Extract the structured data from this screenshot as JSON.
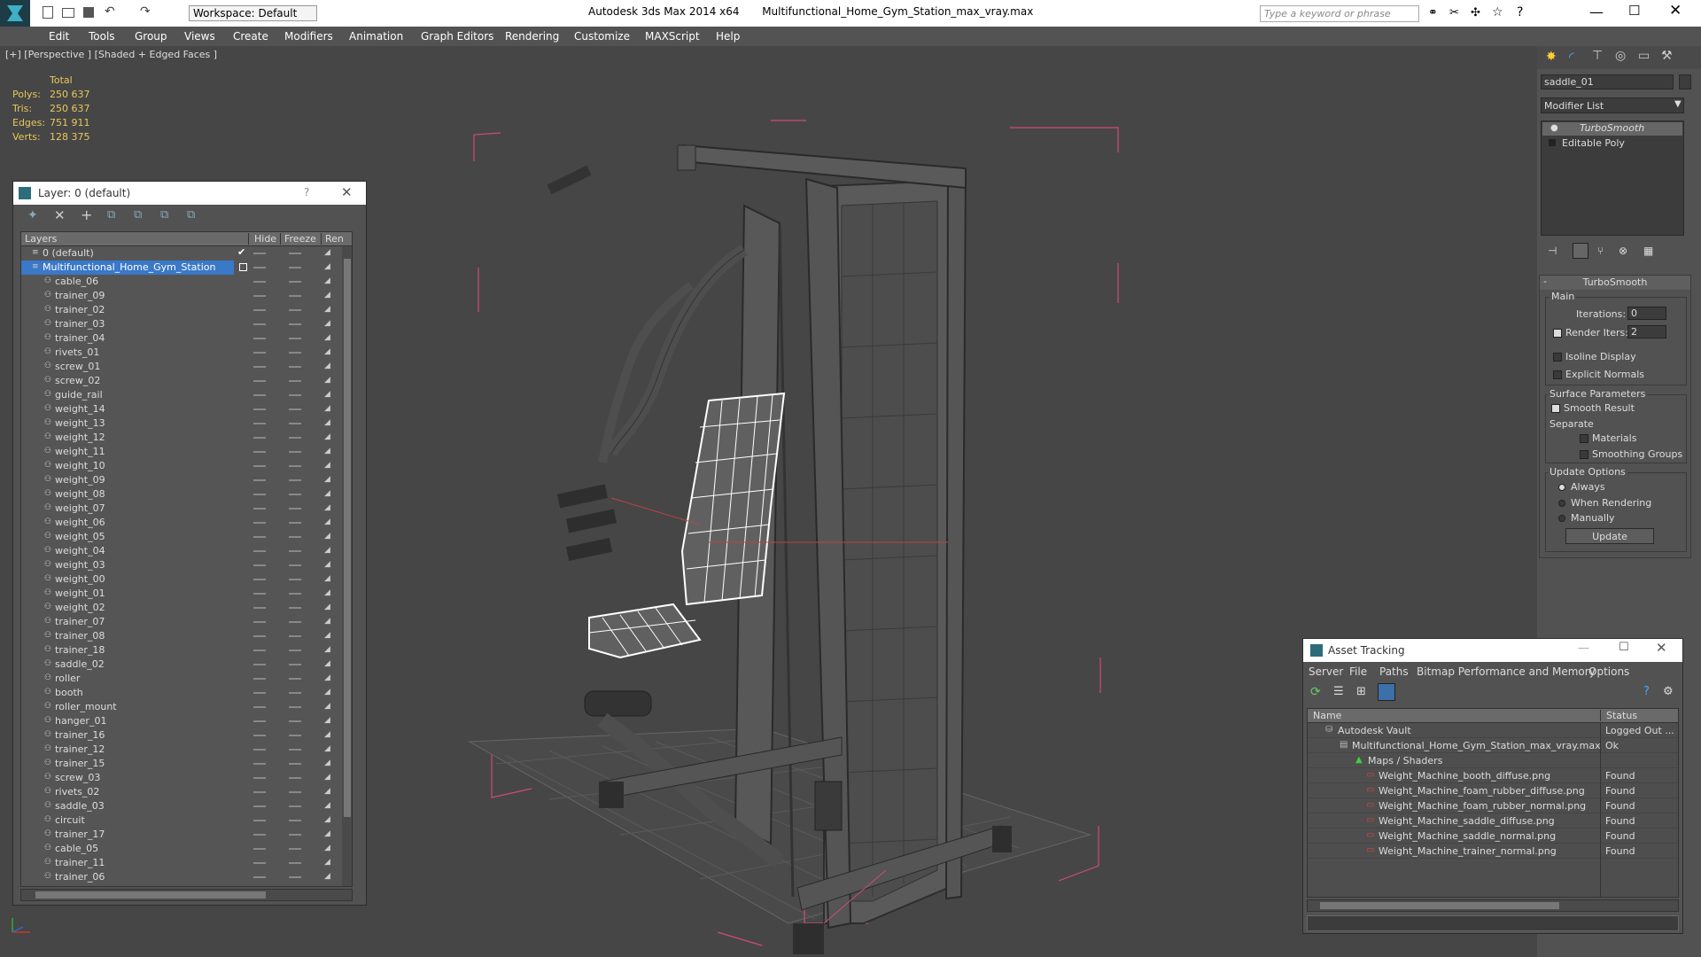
{
  "titlebar": {
    "app": "Autodesk 3ds Max  2014 x64",
    "file": "Multifunctional_Home_Gym_Station_max_vray.max",
    "workspace": "Workspace: Default",
    "search_placeholder": "Type a keyword or phrase"
  },
  "menus": [
    "Edit",
    "Tools",
    "Group",
    "Views",
    "Create",
    "Modifiers",
    "Animation",
    "Graph Editors",
    "Rendering",
    "Customize",
    "MAXScript",
    "Help"
  ],
  "viewport": {
    "label": "[+] [Perspective ] [Shaded + Edged Faces ]",
    "stats": {
      "header": "Total",
      "rows": [
        [
          "Polys:",
          "250 637"
        ],
        [
          "Tris:",
          "250 637"
        ],
        [
          "Edges:",
          "751 911"
        ],
        [
          "Verts:",
          "128 375"
        ]
      ]
    }
  },
  "layer": {
    "title": "Layer: 0 (default)",
    "help": "?",
    "cols": [
      "Layers",
      "Hide",
      "Freeze",
      "Ren"
    ],
    "items": [
      "0 (default)",
      "Multifunctional_Home_Gym_Station",
      "cable_06",
      "trainer_09",
      "trainer_02",
      "trainer_03",
      "trainer_04",
      "rivets_01",
      "screw_01",
      "screw_02",
      "guide_rail",
      "weight_14",
      "weight_13",
      "weight_12",
      "weight_11",
      "weight_10",
      "weight_09",
      "weight_08",
      "weight_07",
      "weight_06",
      "weight_05",
      "weight_04",
      "weight_03",
      "weight_00",
      "weight_01",
      "weight_02",
      "trainer_07",
      "trainer_08",
      "trainer_18",
      "saddle_02",
      "roller",
      "booth",
      "roller_mount",
      "hanger_01",
      "trainer_16",
      "trainer_12",
      "trainer_15",
      "screw_03",
      "rivets_02",
      "saddle_03",
      "circuit",
      "trainer_17",
      "cable_05",
      "trainer_11",
      "trainer_06"
    ]
  },
  "cmd": {
    "object": "saddle_01",
    "modlist": "Modifier List",
    "stack": [
      "TurboSmooth",
      "Editable Poly"
    ],
    "rollout": "TurboSmooth",
    "main": "Main",
    "iter_label": "Iterations:",
    "iter_val": "0",
    "render_label": "Render Iters:",
    "render_val": "2",
    "isoline": "Isoline Display",
    "explicit": "Explicit Normals",
    "surface": "Surface Parameters",
    "smooth": "Smooth Result",
    "separate": "Separate",
    "materials": "Materials",
    "smoothing": "Smoothing Groups",
    "update_opts": "Update Options",
    "always": "Always",
    "when": "When Rendering",
    "manually": "Manually",
    "update_btn": "Update"
  },
  "asset": {
    "title": "Asset Tracking",
    "menus": [
      "Server",
      "File",
      "Paths",
      "Bitmap Performance and Memory",
      "Options"
    ],
    "cols": [
      "Name",
      "Status"
    ],
    "rows": [
      [
        "Autodesk Vault",
        "Logged Out ..."
      ],
      [
        "Multifunctional_Home_Gym_Station_max_vray.max",
        "Ok"
      ],
      [
        "Maps / Shaders",
        ""
      ],
      [
        "Weight_Machine_booth_diffuse.png",
        "Found"
      ],
      [
        "Weight_Machine_foam_rubber_diffuse.png",
        "Found"
      ],
      [
        "Weight_Machine_foam_rubber_normal.png",
        "Found"
      ],
      [
        "Weight_Machine_saddle_diffuse.png",
        "Found"
      ],
      [
        "Weight_Machine_saddle_normal.png",
        "Found"
      ],
      [
        "Weight_Machine_trainer_normal.png",
        "Found"
      ]
    ]
  }
}
